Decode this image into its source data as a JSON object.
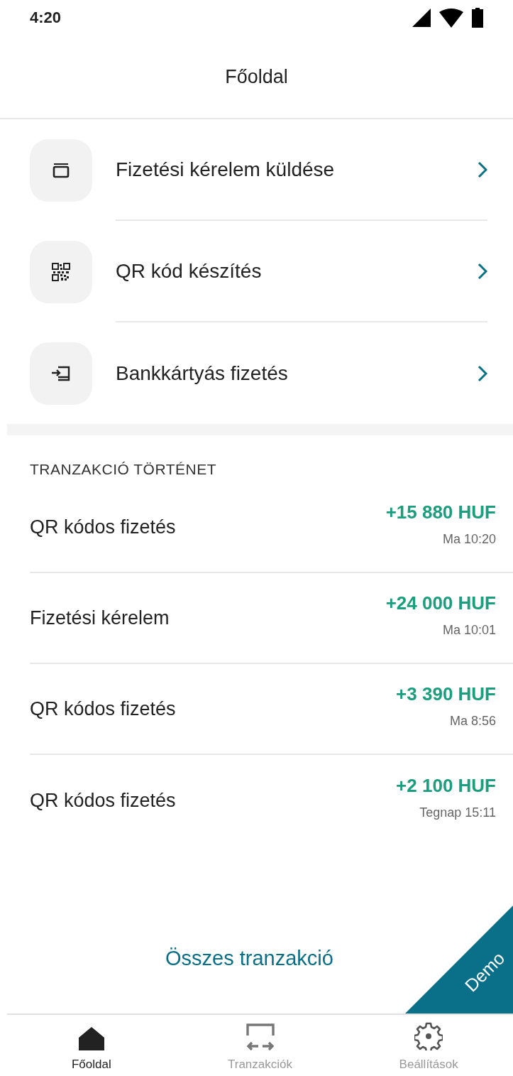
{
  "status_bar": {
    "time": "4:20"
  },
  "header": {
    "title": "Főoldal"
  },
  "actions": [
    {
      "kind": "card",
      "label": "Fizetési kérelem küldése"
    },
    {
      "kind": "qr",
      "label": "QR kód készítés"
    },
    {
      "kind": "card-in",
      "label": "Bankkártyás fizetés"
    }
  ],
  "transactions": {
    "heading": "TRANZAKCIÓ TÖRTÉNET",
    "rows": [
      {
        "name": "QR kódos fizetés",
        "amount": "+15 880 HUF",
        "time": "Ma 10:20"
      },
      {
        "name": "Fizetési kérelem",
        "amount": "+24 000 HUF",
        "time": "Ma 10:01"
      },
      {
        "name": "QR kódos fizetés",
        "amount": "+3 390 HUF",
        "time": "Ma 8:56"
      },
      {
        "name": "QR kódos fizetés",
        "amount": "+2 100 HUF",
        "time": "Tegnap 15:11"
      }
    ],
    "all_link": "Összes tranzakció"
  },
  "demo_ribbon": "Demo",
  "bottom_nav": [
    {
      "kind": "home",
      "label": "Főoldal",
      "selected": true
    },
    {
      "kind": "transfer",
      "label": "Tranzakciók",
      "selected": false
    },
    {
      "kind": "settings",
      "label": "Beállítások",
      "selected": false
    }
  ]
}
